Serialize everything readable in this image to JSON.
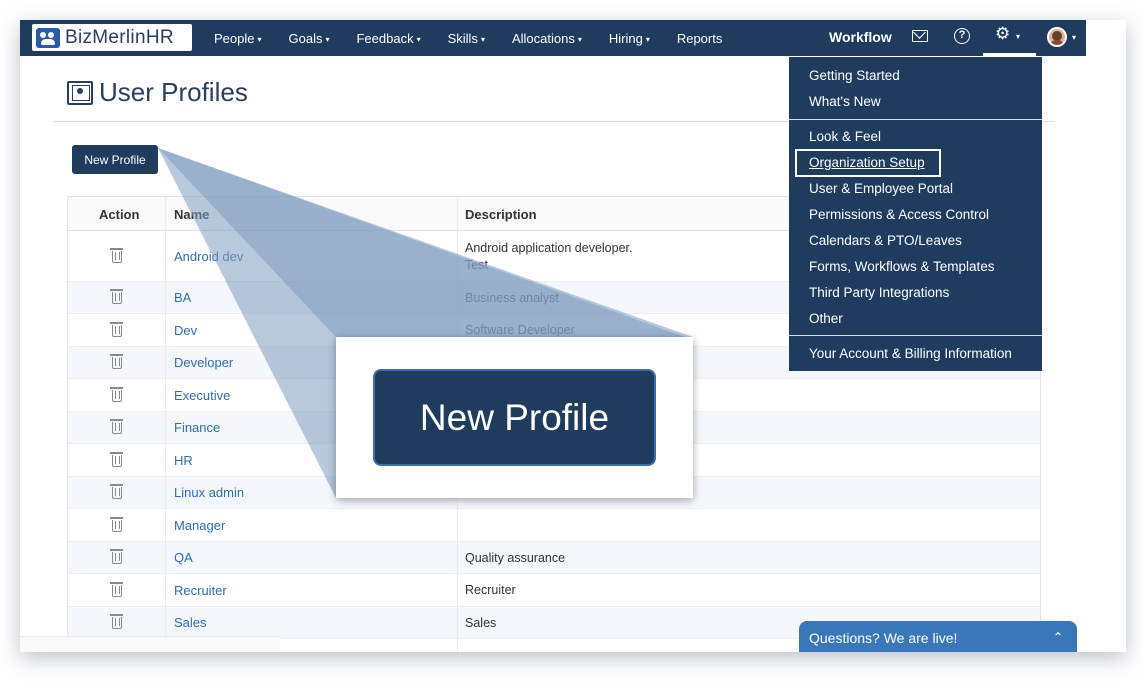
{
  "app": {
    "logo_text": "BizMerlinHR"
  },
  "nav": {
    "items": [
      {
        "label": "People",
        "caret": "▾"
      },
      {
        "label": "Goals",
        "caret": "▾"
      },
      {
        "label": "Feedback",
        "caret": "▾"
      },
      {
        "label": "Skills",
        "caret": "▾"
      },
      {
        "label": "Allocations",
        "caret": "▾"
      },
      {
        "label": "Hiring",
        "caret": "▾"
      },
      {
        "label": "Reports",
        "caret": ""
      }
    ],
    "workflow_label": "Workflow",
    "help_glyph": "?",
    "gear_glyph": "⚙",
    "caret_glyph": "▾"
  },
  "page": {
    "title": "User Profiles",
    "new_profile_label": "New Profile"
  },
  "table": {
    "headers": {
      "action": "Action",
      "name": "Name",
      "description": "Description"
    },
    "rows": [
      {
        "name": "Android dev",
        "description_lines": [
          "Android application developer.",
          "Test"
        ]
      },
      {
        "name": "BA",
        "description_lines": [
          "Business analyst"
        ]
      },
      {
        "name": "Dev",
        "description_lines": [
          "Software Developer"
        ]
      },
      {
        "name": "Developer",
        "description_lines": [
          ""
        ]
      },
      {
        "name": "Executive",
        "description_lines": [
          ""
        ]
      },
      {
        "name": "Finance",
        "description_lines": [
          ""
        ]
      },
      {
        "name": "HR",
        "description_lines": [
          ""
        ]
      },
      {
        "name": "Linux admin",
        "description_lines": [
          ""
        ]
      },
      {
        "name": "Manager",
        "description_lines": [
          ""
        ]
      },
      {
        "name": "QA",
        "description_lines": [
          "Quality assurance"
        ]
      },
      {
        "name": "Recruiter",
        "description_lines": [
          "Recruiter"
        ]
      },
      {
        "name": "Sales",
        "description_lines": [
          "Sales"
        ]
      }
    ]
  },
  "callout": {
    "label": "New Profile"
  },
  "settings_menu": {
    "group1": [
      "Getting Started",
      "What's New"
    ],
    "group2": [
      "Look & Feel",
      "Organization Setup",
      "User & Employee Portal",
      "Permissions & Access Control",
      "Calendars & PTO/Leaves",
      "Forms, Workflows & Templates",
      "Third Party Integrations",
      "Other"
    ],
    "group3": [
      "Your Account & Billing Information"
    ],
    "highlighted": "Organization Setup"
  },
  "chat": {
    "label": "Questions? We are live!",
    "chevron": "⌃"
  },
  "colors": {
    "navbar": "#1f3b5e",
    "link": "#2f6db0",
    "chat": "#3a77b8"
  }
}
